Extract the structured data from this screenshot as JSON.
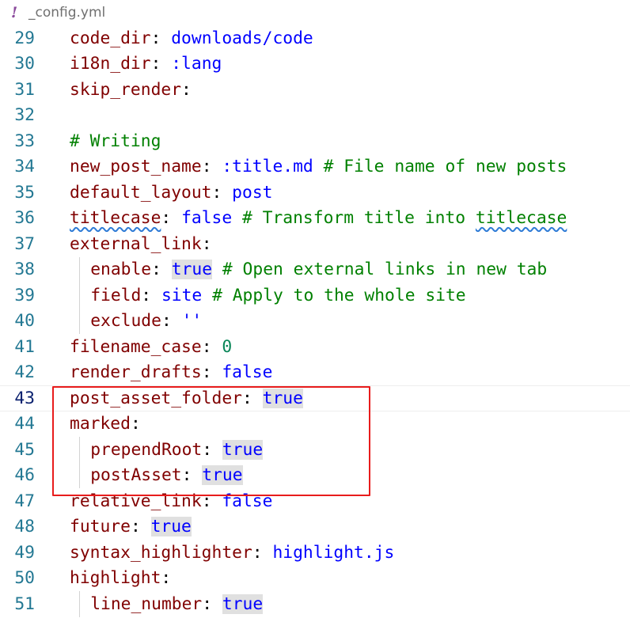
{
  "tab": {
    "icon": "!",
    "title": "_config.yml"
  },
  "lines": [
    {
      "num": "29",
      "indent": 0,
      "tokens": [
        {
          "t": "code_dir",
          "c": "k"
        },
        {
          "t": ": ",
          "c": "p"
        },
        {
          "t": "downloads/code",
          "c": "s"
        }
      ]
    },
    {
      "num": "30",
      "indent": 0,
      "tokens": [
        {
          "t": "i18n_dir",
          "c": "k"
        },
        {
          "t": ": ",
          "c": "p"
        },
        {
          "t": ":lang",
          "c": "s"
        }
      ]
    },
    {
      "num": "31",
      "indent": 0,
      "tokens": [
        {
          "t": "skip_render",
          "c": "k"
        },
        {
          "t": ":",
          "c": "p"
        }
      ]
    },
    {
      "num": "32",
      "indent": 0,
      "tokens": []
    },
    {
      "num": "33",
      "indent": 0,
      "tokens": [
        {
          "t": "# Writing",
          "c": "c"
        }
      ]
    },
    {
      "num": "34",
      "indent": 0,
      "tokens": [
        {
          "t": "new_post_name",
          "c": "k"
        },
        {
          "t": ": ",
          "c": "p"
        },
        {
          "t": ":title.md",
          "c": "s"
        },
        {
          "t": " ",
          "c": "p"
        },
        {
          "t": "# File name of new posts",
          "c": "c"
        }
      ]
    },
    {
      "num": "35",
      "indent": 0,
      "tokens": [
        {
          "t": "default_layout",
          "c": "k"
        },
        {
          "t": ": ",
          "c": "p"
        },
        {
          "t": "post",
          "c": "s"
        }
      ]
    },
    {
      "num": "36",
      "indent": 0,
      "tokens": [
        {
          "t": "titlecase",
          "c": "k sq"
        },
        {
          "t": ": ",
          "c": "p"
        },
        {
          "t": "false",
          "c": "b"
        },
        {
          "t": " ",
          "c": "p"
        },
        {
          "t": "# Transform title into ",
          "c": "c"
        },
        {
          "t": "titlecase",
          "c": "c sq"
        }
      ]
    },
    {
      "num": "37",
      "indent": 0,
      "tokens": [
        {
          "t": "external_link",
          "c": "k"
        },
        {
          "t": ":",
          "c": "p"
        }
      ]
    },
    {
      "num": "38",
      "indent": 1,
      "tokens": [
        {
          "t": "enable",
          "c": "k"
        },
        {
          "t": ": ",
          "c": "p"
        },
        {
          "t": "true",
          "c": "b hl"
        },
        {
          "t": " ",
          "c": "p"
        },
        {
          "t": "# Open external links in new tab",
          "c": "c"
        }
      ]
    },
    {
      "num": "39",
      "indent": 1,
      "tokens": [
        {
          "t": "field",
          "c": "k"
        },
        {
          "t": ": ",
          "c": "p"
        },
        {
          "t": "site",
          "c": "s"
        },
        {
          "t": " ",
          "c": "p"
        },
        {
          "t": "# Apply to the whole site",
          "c": "c"
        }
      ]
    },
    {
      "num": "40",
      "indent": 1,
      "tokens": [
        {
          "t": "exclude",
          "c": "k"
        },
        {
          "t": ": ",
          "c": "p"
        },
        {
          "t": "''",
          "c": "s"
        }
      ]
    },
    {
      "num": "41",
      "indent": 0,
      "tokens": [
        {
          "t": "filename_case",
          "c": "k"
        },
        {
          "t": ": ",
          "c": "p"
        },
        {
          "t": "0",
          "c": "n"
        }
      ]
    },
    {
      "num": "42",
      "indent": 0,
      "tokens": [
        {
          "t": "render_drafts",
          "c": "k"
        },
        {
          "t": ": ",
          "c": "p"
        },
        {
          "t": "false",
          "c": "b"
        }
      ]
    },
    {
      "num": "43",
      "indent": 0,
      "current": true,
      "tokens": [
        {
          "t": "post_asset_folder",
          "c": "k"
        },
        {
          "t": ": ",
          "c": "p"
        },
        {
          "t": "true",
          "c": "b hl"
        }
      ]
    },
    {
      "num": "44",
      "indent": 0,
      "tokens": [
        {
          "t": "marked",
          "c": "k"
        },
        {
          "t": ":",
          "c": "p"
        }
      ]
    },
    {
      "num": "45",
      "indent": 1,
      "tokens": [
        {
          "t": "prependRoot",
          "c": "k"
        },
        {
          "t": ": ",
          "c": "p"
        },
        {
          "t": "true",
          "c": "b hl"
        }
      ]
    },
    {
      "num": "46",
      "indent": 1,
      "tokens": [
        {
          "t": "postAsset",
          "c": "k"
        },
        {
          "t": ": ",
          "c": "p"
        },
        {
          "t": "true",
          "c": "b hl"
        }
      ]
    },
    {
      "num": "47",
      "indent": 0,
      "tokens": [
        {
          "t": "relative_link",
          "c": "k"
        },
        {
          "t": ": ",
          "c": "p"
        },
        {
          "t": "false",
          "c": "b"
        }
      ]
    },
    {
      "num": "48",
      "indent": 0,
      "tokens": [
        {
          "t": "future",
          "c": "k"
        },
        {
          "t": ": ",
          "c": "p"
        },
        {
          "t": "true",
          "c": "b hl"
        }
      ]
    },
    {
      "num": "49",
      "indent": 0,
      "tokens": [
        {
          "t": "syntax_highlighter",
          "c": "k"
        },
        {
          "t": ": ",
          "c": "p"
        },
        {
          "t": "highlight.js",
          "c": "s"
        }
      ]
    },
    {
      "num": "50",
      "indent": 0,
      "tokens": [
        {
          "t": "highlight",
          "c": "k"
        },
        {
          "t": ":",
          "c": "p"
        }
      ]
    },
    {
      "num": "51",
      "indent": 1,
      "tokens": [
        {
          "t": "line_number",
          "c": "k"
        },
        {
          "t": ": ",
          "c": "p"
        },
        {
          "t": "true",
          "c": "b hl"
        }
      ]
    }
  ]
}
